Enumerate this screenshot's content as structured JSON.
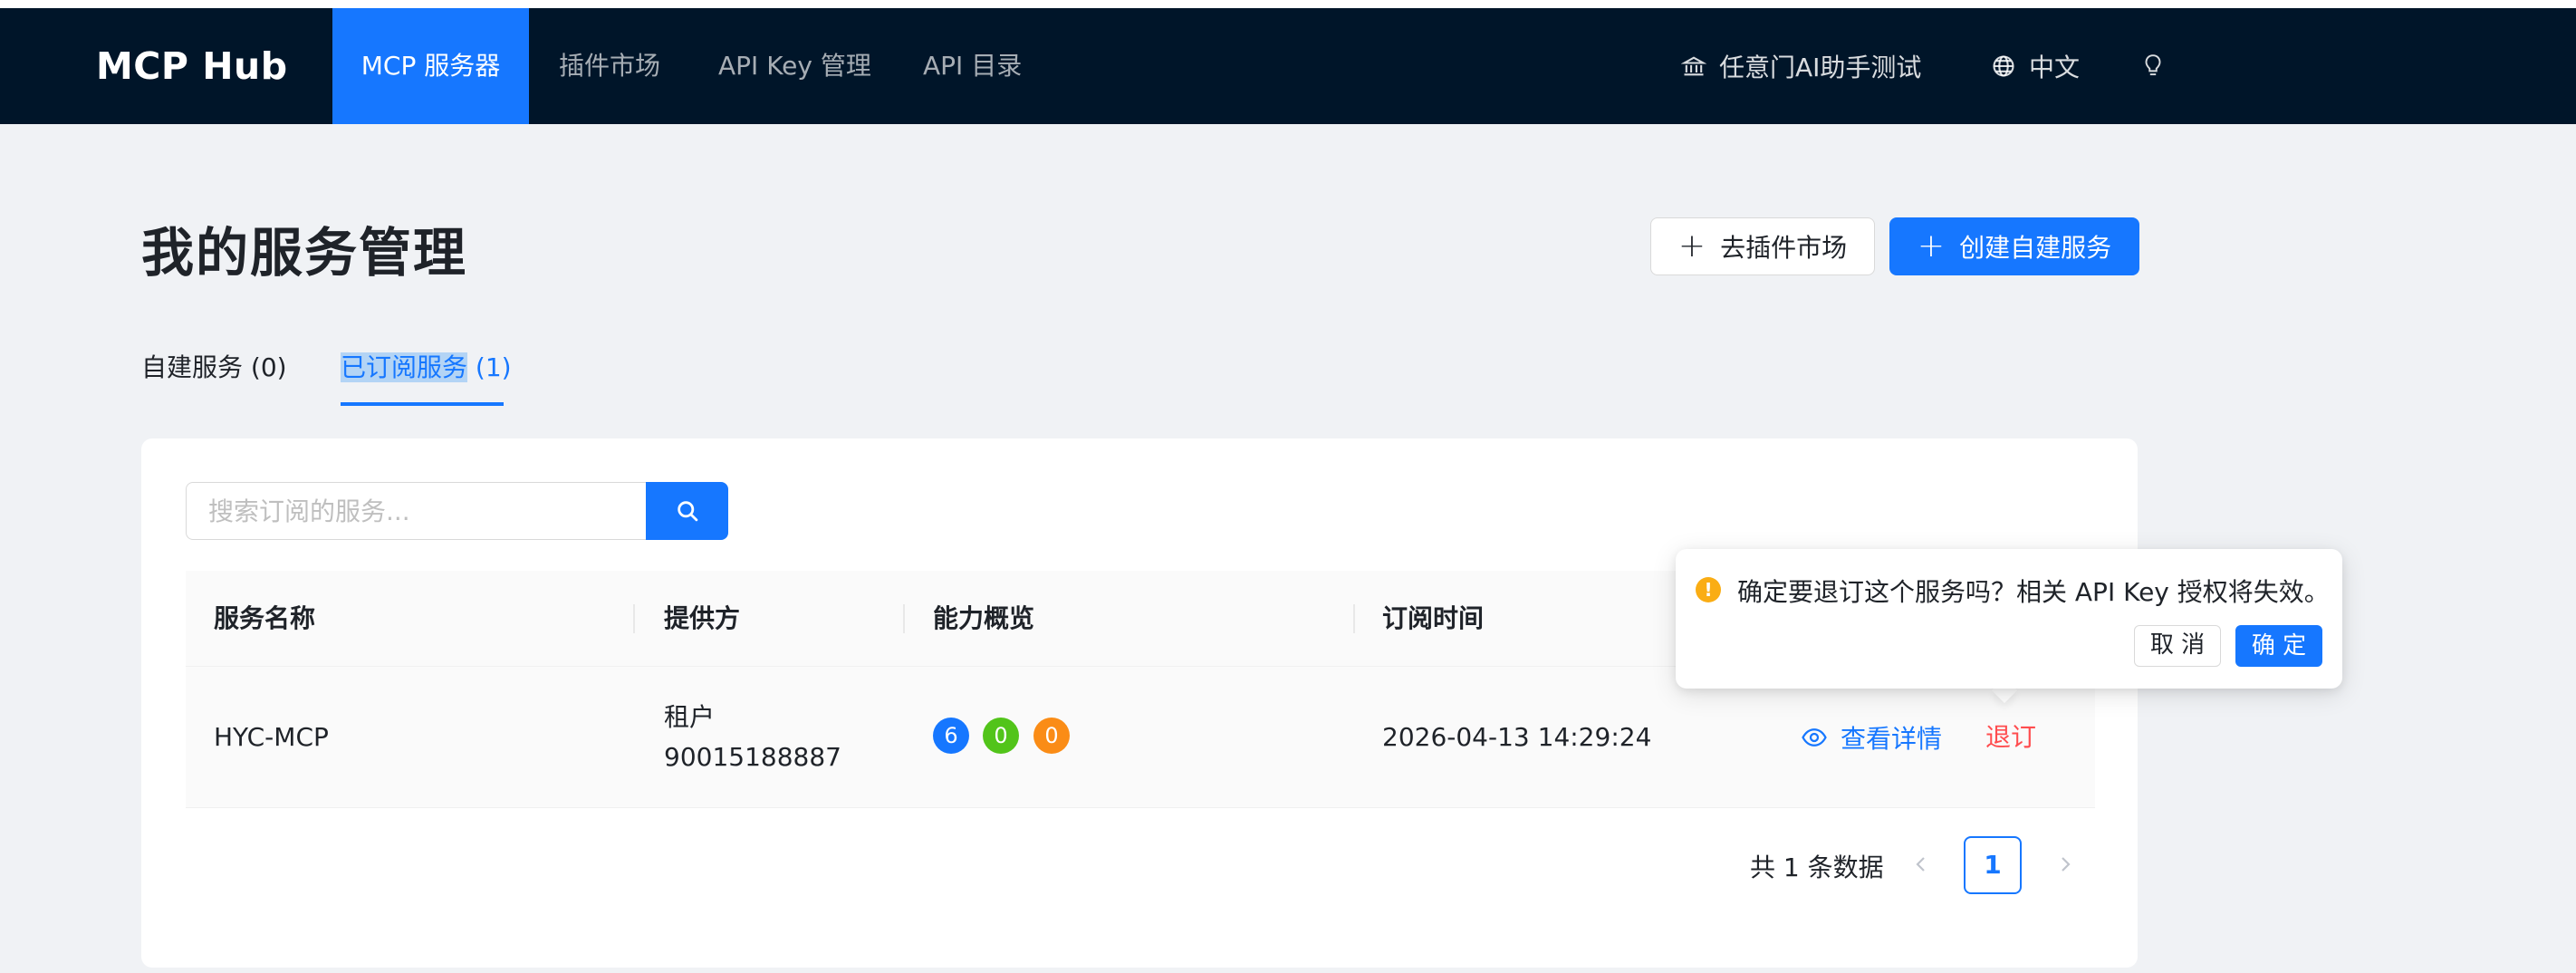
{
  "nav": {
    "brand": "MCP Hub",
    "items": [
      {
        "label": "MCP 服务器",
        "active": true
      },
      {
        "label": "插件市场",
        "active": false
      },
      {
        "label": "API Key 管理",
        "active": false
      },
      {
        "label": "API 目录",
        "active": false
      }
    ],
    "tenant": "任意门AI助手测试",
    "language": "中文",
    "icons": {
      "tenant": "bank-icon",
      "language": "globe-icon",
      "theme": "lightbulb-icon"
    }
  },
  "header": {
    "title": "我的服务管理",
    "market_button": "去插件市场",
    "create_button": "创建自建服务"
  },
  "tabs": [
    {
      "label": "自建服务 (0)",
      "active": false
    },
    {
      "label_highlighted": "已订阅服务",
      "label_rest": " (1)",
      "active": true
    }
  ],
  "search": {
    "placeholder": "搜索订阅的服务...",
    "value": ""
  },
  "table": {
    "columns": [
      "服务名称",
      "提供方",
      "能力概览",
      "订阅时间"
    ],
    "rows": [
      {
        "name": "HYC-MCP",
        "provider_line1": "租户",
        "provider_line2": "90015188887",
        "capabilities": [
          {
            "value": "6",
            "color": "#1677ff"
          },
          {
            "value": "0",
            "color": "#52c41a"
          },
          {
            "value": "0",
            "color": "#fa8c16"
          }
        ],
        "subscribed_at": "2026-04-13 14:29:24",
        "actions": {
          "view": "查看详情",
          "unsubscribe": "退订"
        }
      }
    ]
  },
  "pagination": {
    "total_text": "共 1 条数据",
    "current": "1"
  },
  "popconfirm": {
    "message": "确定要退订这个服务吗？相关 API Key 授权将失效。",
    "cancel": "取 消",
    "ok": "确 定"
  },
  "colors": {
    "primary": "#1677ff",
    "nav_bg": "#001529",
    "danger": "#ff4d4f",
    "warning": "#faad14",
    "page_bg": "#f0f2f5"
  }
}
